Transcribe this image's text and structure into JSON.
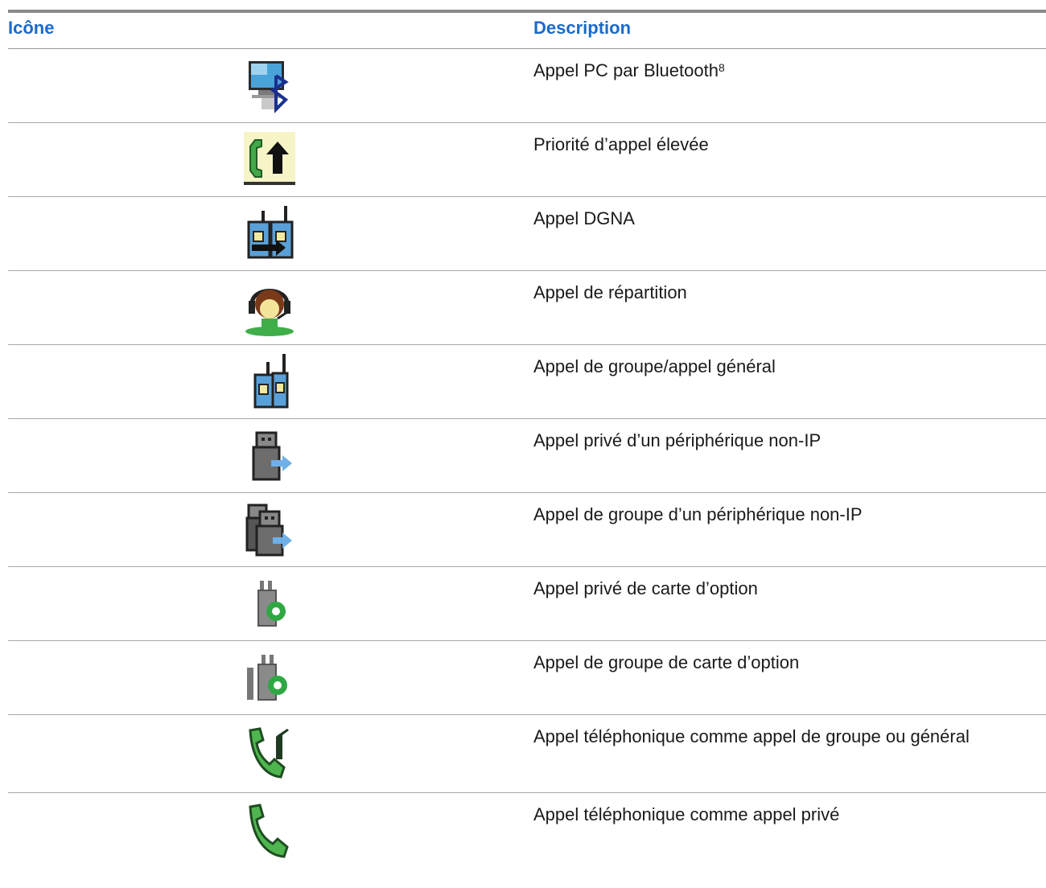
{
  "table": {
    "headers": {
      "icon": "Icône",
      "description": "Description"
    },
    "rows": [
      {
        "icon": "bluetooth-pc-call-icon",
        "description": "Appel PC par Bluetooth",
        "footnote": "8"
      },
      {
        "icon": "high-priority-call-icon",
        "description": "Priorité d’appel élevée"
      },
      {
        "icon": "dgna-call-icon",
        "description": "Appel DGNA"
      },
      {
        "icon": "dispatch-call-icon",
        "description": "Appel de répartition"
      },
      {
        "icon": "group-call-icon",
        "description": "Appel de groupe/appel général"
      },
      {
        "icon": "non-ip-private-call-icon",
        "description": "Appel privé d’un périphérique non-IP"
      },
      {
        "icon": "non-ip-group-call-icon",
        "description": "Appel de groupe d’un périphérique non-IP"
      },
      {
        "icon": "option-board-private-call-icon",
        "description": "Appel privé de carte d’option"
      },
      {
        "icon": "option-board-group-call-icon",
        "description": "Appel de groupe de carte d’option"
      },
      {
        "icon": "phone-group-call-icon",
        "description": "Appel téléphonique comme appel de groupe ou général"
      },
      {
        "icon": "phone-private-call-icon",
        "description": "Appel téléphonique comme appel privé"
      }
    ]
  }
}
